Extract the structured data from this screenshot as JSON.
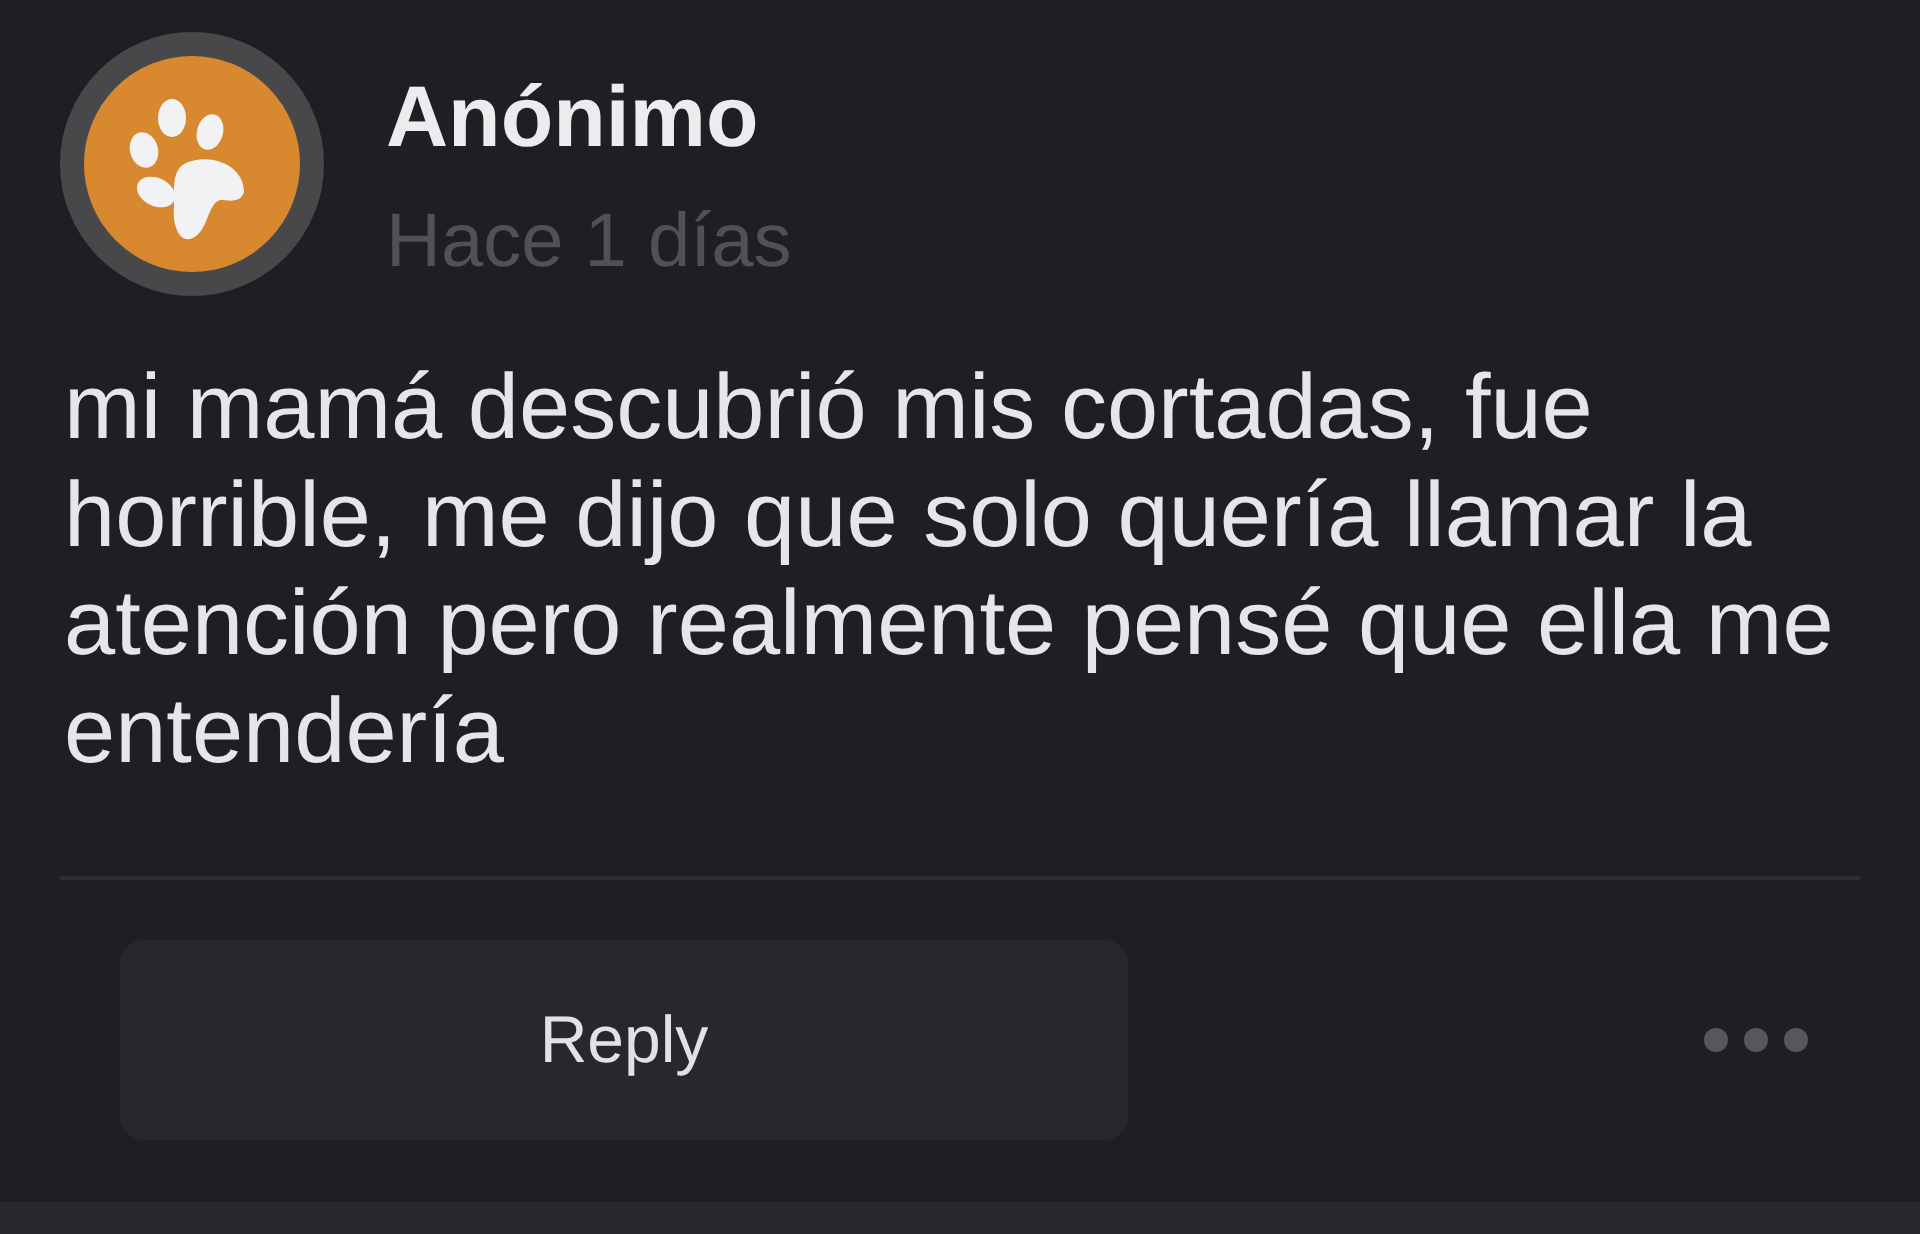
{
  "post": {
    "author": "Anónimo",
    "time": "Hace 1 días",
    "text": "mi mamá descubrió mis cortadas, fue horrible, me dijo que solo quería llamar la atención pero realmente pensé que ella me entendería"
  },
  "actions": {
    "reply_label": "Reply"
  }
}
